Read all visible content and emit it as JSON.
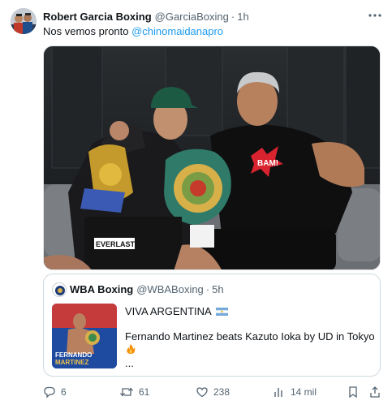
{
  "author": {
    "display_name": "Robert Garcia Boxing",
    "handle": "@GarciaBoxing",
    "separator": "·",
    "time": "1h"
  },
  "tweet": {
    "text": "Nos vemos pronto ",
    "mention": "@chinomaidanapro"
  },
  "media": {
    "shirt_text": "BAM!",
    "trunks_text": "EVERLAST"
  },
  "quote": {
    "display_name": "WBA Boxing",
    "handle": "@WBABoxing",
    "separator": "·",
    "time": "5h",
    "line1": "VIVA ARGENTINA",
    "line2": "Fernando Martinez beats Kazuto Ioka by UD in Tokyo",
    "ellipsis": "...",
    "thumb_name_1": "FERNANDO",
    "thumb_name_2": "MARTINEZ"
  },
  "actions": {
    "replies": "6",
    "reposts": "61",
    "likes": "238",
    "views": "14 mil"
  },
  "colors": {
    "accent": "#1d9bf0",
    "secondary_text": "#536471",
    "border": "#cfd9de"
  }
}
